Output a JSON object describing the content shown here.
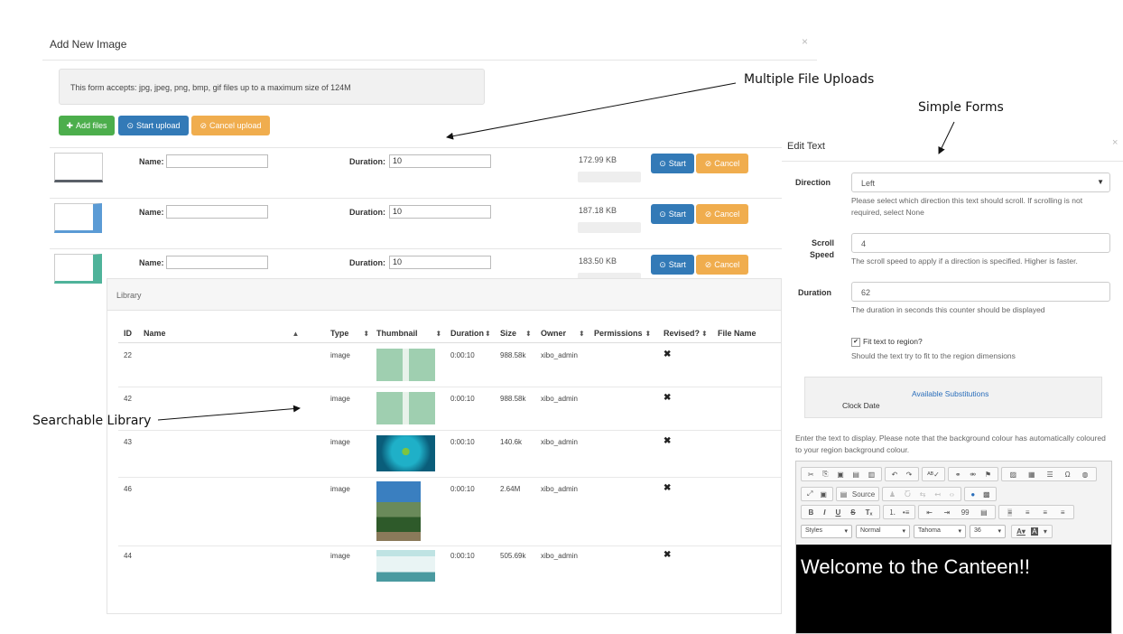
{
  "annotations": {
    "multiple_uploads": "Multiple File Uploads",
    "simple_forms": "Simple Forms",
    "searchable_library": "Searchable Library"
  },
  "add_image": {
    "title": "Add New Image",
    "close": "×",
    "info": "This form accepts: jpg, jpeg, png, bmp, gif files up to a maximum size of 124M",
    "buttons": {
      "add_files": "Add files",
      "start_upload": "Start upload",
      "cancel_upload": "Cancel upload"
    },
    "rows": [
      {
        "name_label": "Name:",
        "name_value": "",
        "duration_label": "Duration:",
        "duration_value": "10",
        "size": "172.99 KB",
        "start": "Start",
        "cancel": "Cancel",
        "thumb_color": "#5a6068"
      },
      {
        "name_label": "Name:",
        "name_value": "",
        "duration_label": "Duration:",
        "duration_value": "10",
        "size": "187.18 KB",
        "start": "Start",
        "cancel": "Cancel",
        "thumb_color": "#5b9bd5"
      },
      {
        "name_label": "Name:",
        "name_value": "",
        "duration_label": "Duration:",
        "duration_value": "10",
        "size": "183.50 KB",
        "start": "Start",
        "cancel": "Cancel",
        "thumb_color": "#4fb39a"
      }
    ]
  },
  "library": {
    "title": "Library",
    "columns": [
      "ID",
      "Name",
      "Type",
      "Thumbnail",
      "Duration",
      "Size",
      "Owner",
      "Permissions",
      "Revised?",
      "File Name"
    ],
    "rows": [
      {
        "id": "22",
        "type": "image",
        "duration": "0:00:10",
        "size": "988.58k",
        "owner": "xibo_admin",
        "revised": "✖"
      },
      {
        "id": "42",
        "type": "image",
        "duration": "0:00:10",
        "size": "988.58k",
        "owner": "xibo_admin",
        "revised": "✖"
      },
      {
        "id": "43",
        "type": "image",
        "duration": "0:00:10",
        "size": "140.6k",
        "owner": "xibo_admin",
        "revised": "✖"
      },
      {
        "id": "46",
        "type": "image",
        "duration": "0:00:10",
        "size": "2.64M",
        "owner": "xibo_admin",
        "revised": "✖"
      },
      {
        "id": "44",
        "type": "image",
        "duration": "0:00:10",
        "size": "505.69k",
        "owner": "xibo_admin",
        "revised": "✖"
      }
    ]
  },
  "edit_text": {
    "title": "Edit Text",
    "close": "×",
    "direction_label": "Direction",
    "direction_value": "Left",
    "direction_help": "Please select which direction this text should scroll. If scrolling is not required, select None",
    "scroll_label_1": "Scroll",
    "scroll_label_2": "Speed",
    "scroll_value": "4",
    "scroll_help": "The scroll speed to apply if a direction is specified. Higher is faster.",
    "duration_label": "Duration",
    "duration_value": "62",
    "duration_help": "The duration in seconds this counter should be displayed",
    "fit_label": "Fit text to region?",
    "fit_checked": true,
    "fit_help": "Should the text try to fit to the region dimensions",
    "substitutions_link": "Available Substitutions",
    "substitution_item": "Clock Date",
    "editor_help": "Enter the text to display. Please note that the background colour has automatically coloured to your region background colour.",
    "toolbar": {
      "source": "Source",
      "styles": "Styles",
      "format": "Normal",
      "font": "Tahoma",
      "size": "36"
    },
    "editor_content": "Welcome to the Canteen!!"
  }
}
